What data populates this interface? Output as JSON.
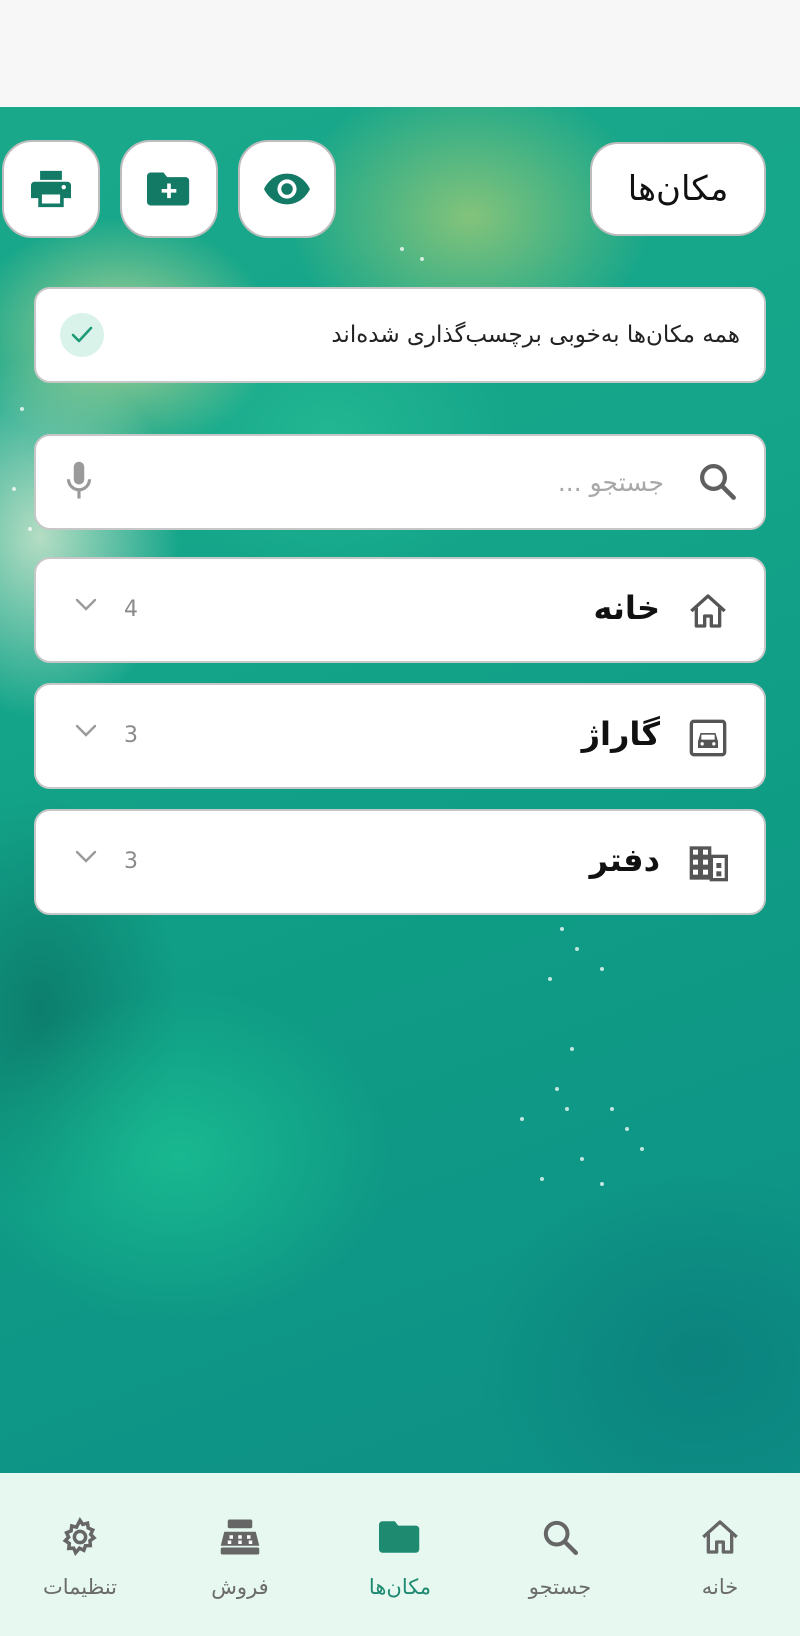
{
  "header": {
    "title": "مکان‌ها",
    "actions": [
      {
        "name": "print",
        "icon": "printer-icon"
      },
      {
        "name": "new-folder",
        "icon": "folder-plus-icon"
      },
      {
        "name": "view",
        "icon": "eye-icon"
      }
    ]
  },
  "status": {
    "text": "همه مکان‌ها به‌خوبی برچسب‌گذاری شده‌اند",
    "icon": "check-icon"
  },
  "search": {
    "placeholder": "جستجو ...",
    "value": ""
  },
  "locations": [
    {
      "name": "خانه",
      "count": "4",
      "icon": "home-icon"
    },
    {
      "name": "گاراژ",
      "count": "3",
      "icon": "garage-icon"
    },
    {
      "name": "دفتر",
      "count": "3",
      "icon": "office-building-icon"
    }
  ],
  "bottom_nav": {
    "items": [
      {
        "label": "خانه",
        "icon": "home-icon"
      },
      {
        "label": "جستجو",
        "icon": "search-icon"
      },
      {
        "label": "مکان‌ها",
        "icon": "folder-icon",
        "active": true
      },
      {
        "label": "فروش",
        "icon": "cash-register-icon"
      },
      {
        "label": "تنظیمات",
        "icon": "gear-icon"
      }
    ]
  },
  "colors": {
    "accent": "#137a66",
    "nav_active": "#1e8a70",
    "nav_background": "#e6f8f0",
    "check_background": "#d9f3ea"
  }
}
